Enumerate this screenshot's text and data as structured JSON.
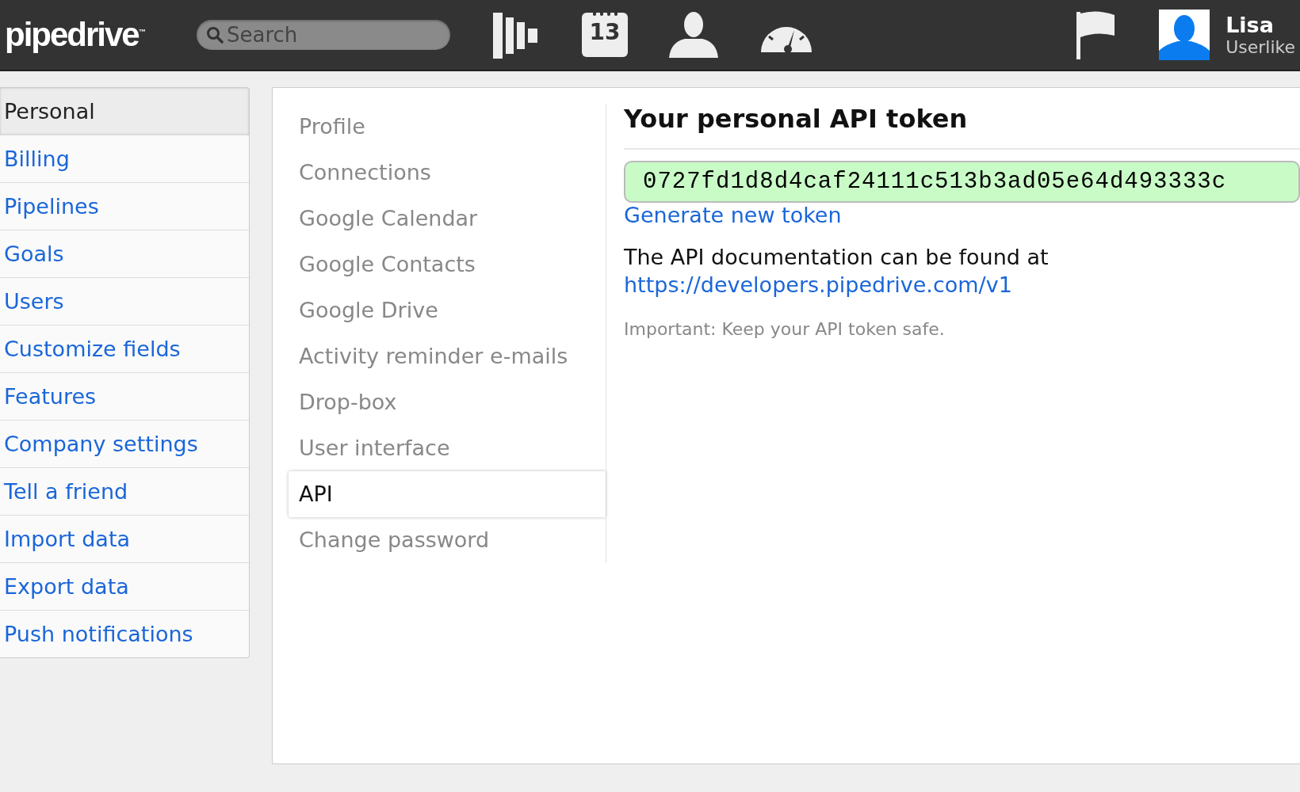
{
  "topbar": {
    "logo": "pipedrive",
    "logo_mark": "™",
    "search": {
      "placeholder": "Search"
    },
    "calendar_day": "13",
    "user": {
      "name": "Lisa",
      "company": "Userlike"
    }
  },
  "sidebar": {
    "items": [
      {
        "label": "Personal",
        "selected": true
      },
      {
        "label": "Billing",
        "selected": false
      },
      {
        "label": "Pipelines",
        "selected": false
      },
      {
        "label": "Goals",
        "selected": false
      },
      {
        "label": "Users",
        "selected": false
      },
      {
        "label": "Customize fields",
        "selected": false
      },
      {
        "label": "Features",
        "selected": false
      },
      {
        "label": "Company settings",
        "selected": false
      },
      {
        "label": "Tell a friend",
        "selected": false
      },
      {
        "label": "Import data",
        "selected": false
      },
      {
        "label": "Export data",
        "selected": false
      },
      {
        "label": "Push notifications",
        "selected": false
      }
    ]
  },
  "subnav": {
    "items": [
      {
        "label": "Profile",
        "selected": false
      },
      {
        "label": "Connections",
        "selected": false
      },
      {
        "label": "Google Calendar",
        "selected": false
      },
      {
        "label": "Google Contacts",
        "selected": false
      },
      {
        "label": "Google Drive",
        "selected": false
      },
      {
        "label": "Activity reminder e-mails",
        "selected": false
      },
      {
        "label": "Drop-box",
        "selected": false
      },
      {
        "label": "User interface",
        "selected": false
      },
      {
        "label": "API",
        "selected": true
      },
      {
        "label": "Change password",
        "selected": false
      }
    ]
  },
  "content": {
    "title": "Your personal API token",
    "token": "0727fd1d8d4caf24111c513b3ad05e64d493333c",
    "generate_link": "Generate new token",
    "doc_text": "The API documentation can be found at",
    "doc_link": "https://developers.pipedrive.com/v1",
    "note": "Important: Keep your API token safe."
  }
}
